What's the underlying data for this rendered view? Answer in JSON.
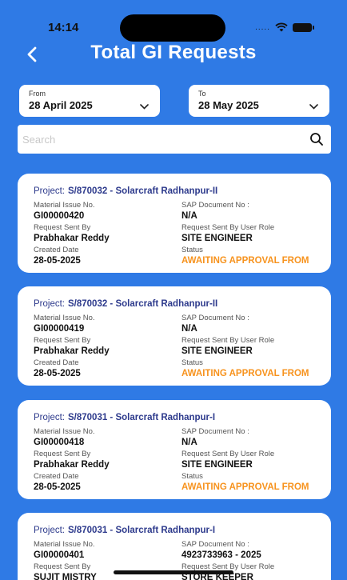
{
  "status_bar": {
    "time": "14:14",
    "signal": "....."
  },
  "header": {
    "title": "Total GI Requests"
  },
  "filters": {
    "from_label": "From",
    "from_value": "28 April 2025",
    "to_label": "To",
    "to_value": "28 May 2025"
  },
  "search": {
    "placeholder": "Search"
  },
  "field_labels": {
    "project": "Project:",
    "material_issue_no": "Material Issue No.",
    "sap_document_no": "SAP Document No :",
    "request_sent_by": "Request Sent By",
    "request_sent_by_role": "Request Sent By User Role",
    "created_date": "Created Date",
    "status": "Status"
  },
  "requests": [
    {
      "project": "S/870032 - Solarcraft Radhanpur-II",
      "material_issue_no": "GI00000420",
      "sap_document_no": "N/A",
      "request_sent_by": "Prabhakar Reddy",
      "user_role": "SITE ENGINEER",
      "created_date": "28-05-2025",
      "status": "AWAITING APPROVAL FROM"
    },
    {
      "project": "S/870032 - Solarcraft Radhanpur-II",
      "material_issue_no": "GI00000419",
      "sap_document_no": "N/A",
      "request_sent_by": "Prabhakar Reddy",
      "user_role": "SITE ENGINEER",
      "created_date": "28-05-2025",
      "status": "AWAITING APPROVAL FROM"
    },
    {
      "project": "S/870031 - Solarcraft Radhanpur-I",
      "material_issue_no": "GI00000418",
      "sap_document_no": "N/A",
      "request_sent_by": "Prabhakar Reddy",
      "user_role": "SITE ENGINEER",
      "created_date": "28-05-2025",
      "status": "AWAITING APPROVAL FROM"
    },
    {
      "project": "S/870031 - Solarcraft Radhanpur-I",
      "material_issue_no": "GI00000401",
      "sap_document_no": "4923733963 - 2025",
      "request_sent_by": "SUJIT MISTRY",
      "user_role": "STORE KEEPER",
      "created_date": "",
      "status": ""
    }
  ],
  "colors": {
    "background": "#2f7ae5",
    "project_text": "#2d3a8c",
    "status_text": "#f7931e"
  },
  "icons": [
    "back-icon",
    "chevron-down-icon",
    "search-icon",
    "wifi-icon",
    "battery-icon"
  ]
}
